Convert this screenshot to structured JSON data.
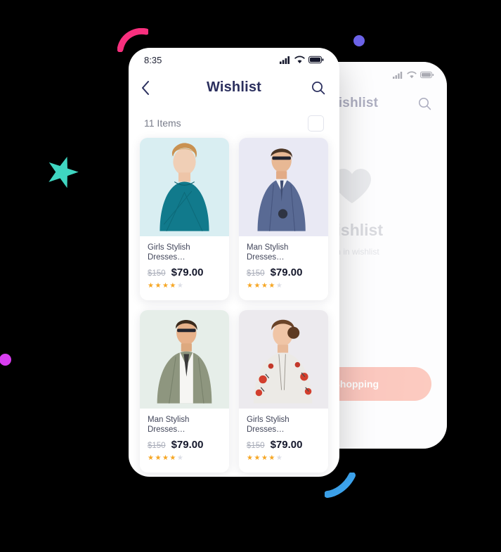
{
  "front_phone": {
    "status_bar": {
      "time": "8:35",
      "icons": [
        "signal-icon",
        "wifi-icon",
        "battery-icon"
      ]
    },
    "header": {
      "back_icon": "chevron-left-icon",
      "title": "Wishlist",
      "search_icon": "search-icon"
    },
    "subbar": {
      "count_label": "11 Items",
      "select_all": ""
    },
    "products": [
      {
        "name": "Girls Stylish Dresses…",
        "old_price": "$150",
        "price": "$79.00",
        "rating": 4,
        "rating_max": 5,
        "image_alt": "woman-in-teal-dress",
        "bg_class": "bg-a"
      },
      {
        "name": "Man Stylish Dresses…",
        "old_price": "$150",
        "price": "$79.00",
        "rating": 4,
        "rating_max": 5,
        "image_alt": "man-in-blue-suit-with-sunglasses",
        "bg_class": "bg-b"
      },
      {
        "name": "Man Stylish Dresses…",
        "old_price": "$150",
        "price": "$79.00",
        "rating": 4,
        "rating_max": 5,
        "image_alt": "man-in-sage-green-blazer",
        "bg_class": "bg-c"
      },
      {
        "name": "Girls Stylish Dresses…",
        "old_price": "$150",
        "price": "$79.00",
        "rating": 4,
        "rating_max": 5,
        "image_alt": "woman-in-embroidered-floral-blouse",
        "bg_class": "bg-d"
      }
    ]
  },
  "back_phone": {
    "status_bar": {
      "icons": [
        "signal-icon",
        "wifi-icon",
        "battery-icon"
      ]
    },
    "header": {
      "title": "Wishlist",
      "search_icon": "search-icon"
    },
    "empty_state": {
      "heart_icon": "heart-icon",
      "title": "Wishlist",
      "subtitle": "item in wishlist"
    },
    "cta_label": "e Shopping"
  },
  "decor": {
    "shapes": [
      {
        "name": "arc-pink",
        "color": "#f9317f"
      },
      {
        "name": "dot-purple",
        "color": "#6c63e8"
      },
      {
        "name": "star-teal",
        "color": "#3fd6c1"
      },
      {
        "name": "dot-magenta",
        "color": "#d93ef0"
      },
      {
        "name": "arc-blue",
        "color": "#3fa9f5"
      }
    ]
  },
  "colors": {
    "background": "#000000",
    "title": "#2b2f5e",
    "price": "#14172b",
    "star_on": "#f6a623",
    "star_off": "#dcdee6",
    "cta": "#f2604f"
  }
}
